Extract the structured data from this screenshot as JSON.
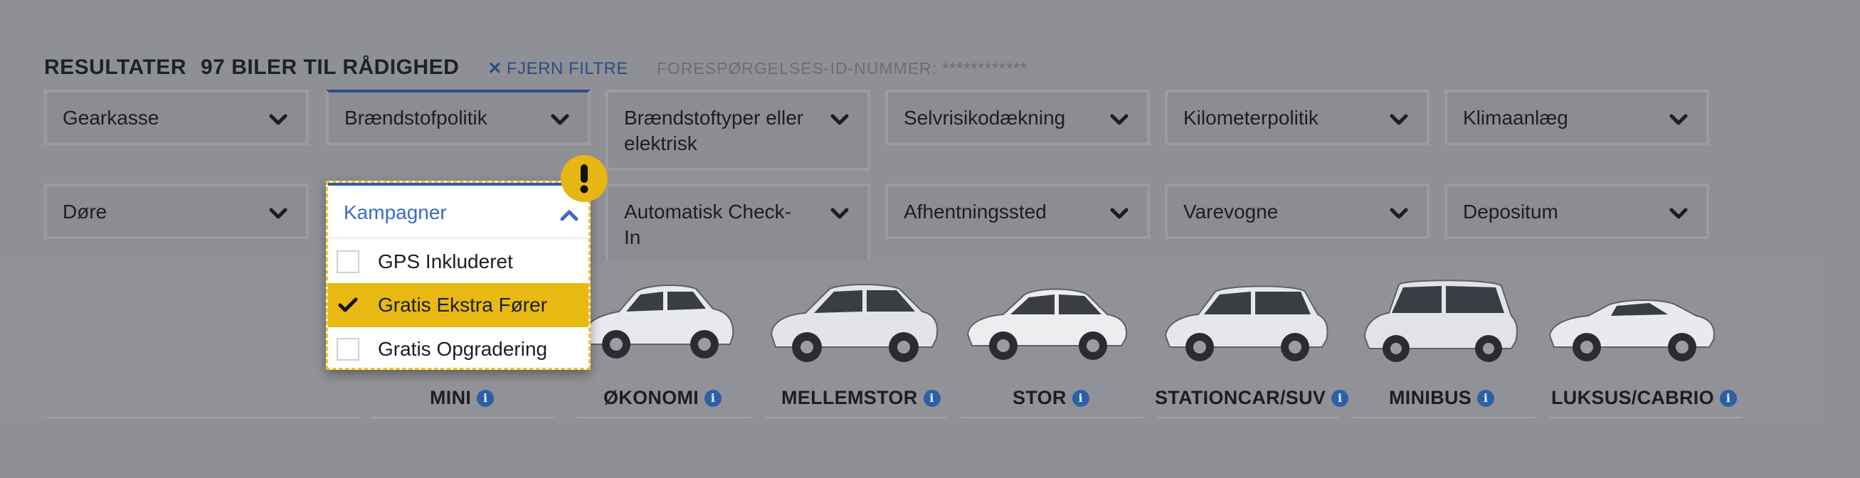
{
  "header": {
    "results_label": "RESULTATER",
    "count_label": "97 BILER TIL RÅDIGHED",
    "remove_filters_label": "FJERN FILTRE",
    "request_id_label": "FORESPØRGELSES-ID-NUMMER: ************"
  },
  "filters_row1": [
    {
      "label": "Gearkasse",
      "icon": "chevron-down-icon"
    },
    {
      "label": "Brændstofpolitik",
      "icon": "chevron-down-icon"
    },
    {
      "label": "Brændstoftyper eller elektrisk",
      "icon": "chevron-down-icon"
    },
    {
      "label": "Selvrisikodækning",
      "icon": "chevron-down-icon"
    },
    {
      "label": "Kilometerpolitik",
      "icon": "chevron-down-icon"
    },
    {
      "label": "Klimaanlæg",
      "icon": "chevron-down-icon"
    }
  ],
  "filters_row2": [
    {
      "label": "Døre",
      "icon": "chevron-down-icon"
    },
    {
      "label": "Kampagner",
      "icon": "chevron-up-icon",
      "expanded": true
    },
    {
      "label": "Automatisk Check-In",
      "icon": "chevron-down-icon"
    },
    {
      "label": "Afhentningssted",
      "icon": "chevron-down-icon"
    },
    {
      "label": "Varevogne",
      "icon": "chevron-down-icon"
    },
    {
      "label": "Depositum",
      "icon": "chevron-down-icon"
    }
  ],
  "kampagner_options": [
    {
      "label": "GPS Inkluderet",
      "checked": false
    },
    {
      "label": "Gratis Ekstra Fører",
      "checked": true
    },
    {
      "label": "Gratis Opgradering",
      "checked": false
    }
  ],
  "warning_icon": "exclamation-icon",
  "car_categories": [
    {
      "label": "MINI"
    },
    {
      "label": "ØKONOMI"
    },
    {
      "label": "MELLEMSTOR"
    },
    {
      "label": "STOR"
    },
    {
      "label": "STATIONCAR/SUV"
    },
    {
      "label": "MINIBUS"
    },
    {
      "label": "LUKSUS/CABRIO"
    }
  ],
  "colors": {
    "overlay_bg": "#8f9095",
    "accent_blue": "#2d5fa6",
    "highlight_yellow": "#e8b912",
    "warning_yellow": "#e6b614"
  }
}
